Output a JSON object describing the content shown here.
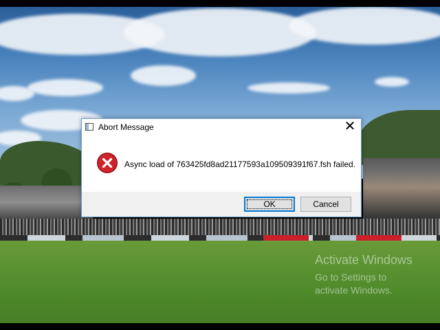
{
  "dialog": {
    "title": "Abort Message",
    "close_label": "✕",
    "message": "Async load of 763425fd8ad21177593a109509391f67.fsh failed.",
    "ok_label": "OK",
    "cancel_label": "Cancel",
    "icon": "error-icon"
  },
  "watermark": {
    "title": "Activate Windows",
    "line1": "Go to Settings to",
    "line2": "activate Windows."
  },
  "colors": {
    "error_red": "#d0242b",
    "accent_blue": "#0078d7",
    "button_area": "#f0f0f0"
  }
}
